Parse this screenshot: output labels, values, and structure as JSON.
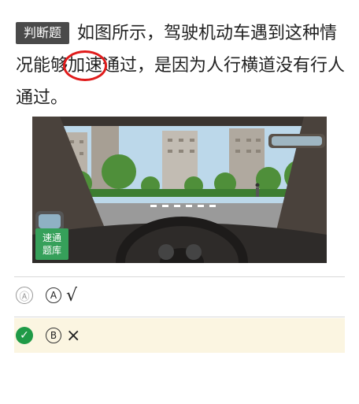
{
  "question": {
    "type_label": "判断题",
    "text_before": "如图所示，驾驶机动车遇到这种情况能够",
    "highlight": "加速",
    "text_after": "通过，是因为人行横道没有行人通过。"
  },
  "figure": {
    "watermark": "速通\n题库"
  },
  "options": [
    {
      "state_icon": "Ⓐ",
      "letter": "A",
      "text": "√",
      "correct": false
    },
    {
      "state_icon": "✓",
      "letter": "B",
      "text": "×",
      "correct": true
    }
  ],
  "colors": {
    "correct_bg": "#fbf5e1",
    "check_green": "#1f9a47",
    "highlight_circle": "#e01b1b"
  }
}
